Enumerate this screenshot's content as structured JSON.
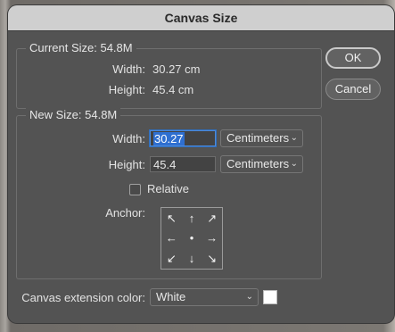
{
  "dialog": {
    "title": "Canvas Size"
  },
  "buttons": {
    "ok": "OK",
    "cancel": "Cancel"
  },
  "current_size": {
    "legend": "Current Size: 54.8M",
    "width_label": "Width:",
    "width_value": "30.27 cm",
    "height_label": "Height:",
    "height_value": "45.4 cm"
  },
  "new_size": {
    "legend": "New Size: 54.8M",
    "width_label": "Width:",
    "width_value": "30.27",
    "width_unit": "Centimeters",
    "height_label": "Height:",
    "height_value": "45.4",
    "height_unit": "Centimeters",
    "relative_label": "Relative",
    "relative_checked": false,
    "anchor_label": "Anchor:",
    "anchor_icons": [
      "arrow-up-left-icon",
      "arrow-up-icon",
      "arrow-up-right-icon",
      "arrow-left-icon",
      "anchor-center-dot-icon",
      "arrow-right-icon",
      "arrow-down-left-icon",
      "arrow-down-icon",
      "arrow-down-right-icon"
    ],
    "anchor_glyphs": [
      "↖",
      "↑",
      "↗",
      "←",
      "●",
      "→",
      "↙",
      "↓",
      "↘"
    ]
  },
  "extension": {
    "label": "Canvas extension color:",
    "value": "White",
    "swatch_color": "#ffffff"
  }
}
